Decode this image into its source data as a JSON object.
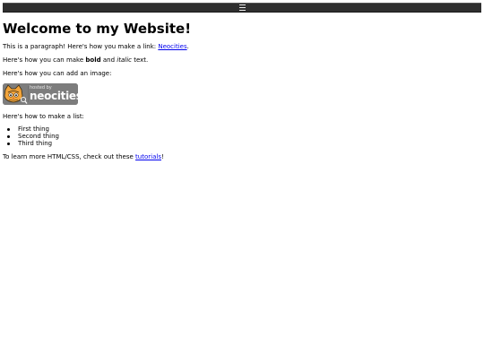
{
  "menu": {
    "icon": "hamburger-menu-icon"
  },
  "title": "Welcome to my Website!",
  "intro": {
    "text": "This is a paragraph! Here's how you make a link: ",
    "link": "Neocities",
    "after": "."
  },
  "format": {
    "before": "Here's how you can make ",
    "bold": "bold",
    "middle": " and ",
    "italic": "italic",
    "after": " text."
  },
  "image_intro": "Here's how you can add an image:",
  "badge": {
    "small_text": "hosted by",
    "brand": "neocities",
    "icon": "neocities-cat-icon",
    "bg_color": "#7d7d7d"
  },
  "list_intro": "Here's how to make a list:",
  "list": [
    "First thing",
    "Second thing",
    "Third thing"
  ],
  "outro": {
    "text": "To learn more HTML/CSS, check out these ",
    "link": "tutorials",
    "after": "!"
  }
}
